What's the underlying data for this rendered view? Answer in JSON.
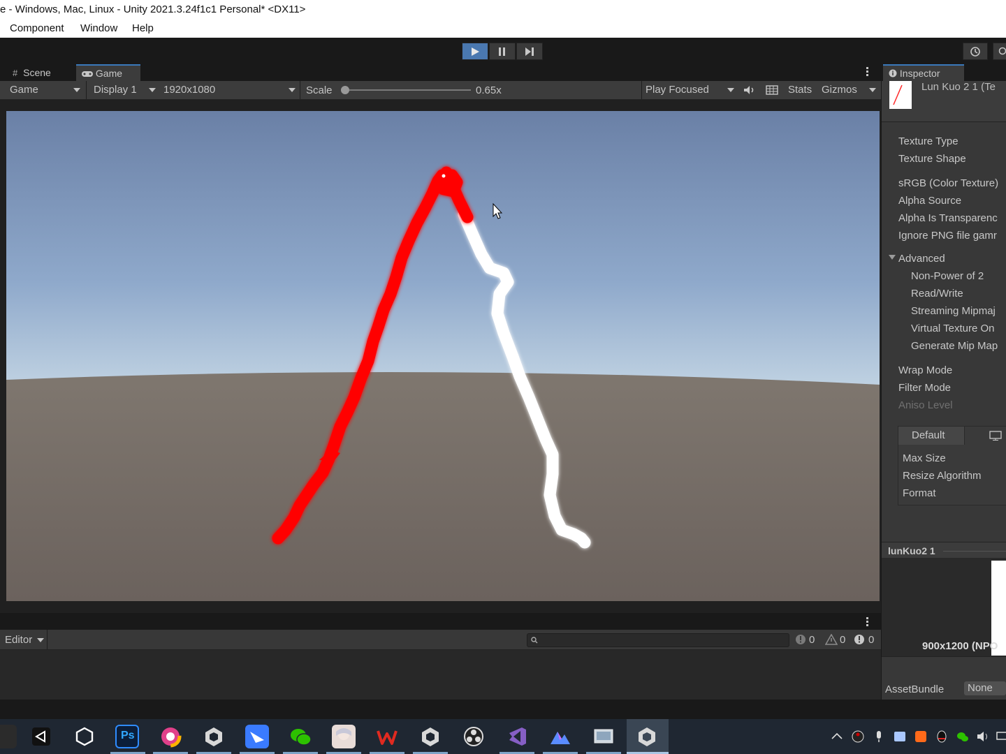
{
  "window": {
    "title": "e - Windows, Mac, Linux - Unity 2021.3.24f1c1 Personal* <DX11>"
  },
  "menu": {
    "items": [
      "Component",
      "Window",
      "Help"
    ]
  },
  "toolbar": {
    "play_icon": "play-icon",
    "pause_icon": "pause-icon",
    "step_icon": "step-icon",
    "history_icon": "history-icon"
  },
  "game_view": {
    "tabs": {
      "scene": "Scene",
      "game": "Game"
    },
    "mode": "Game",
    "display": "Display 1",
    "resolution": "1920x1080",
    "scale_label": "Scale",
    "scale_value": "0.65x",
    "scale_level": 0.0,
    "play_mode": "Play Focused",
    "stats": "Stats",
    "gizmos": "Gizmos",
    "stroke_colors": {
      "red": "#ff0000",
      "white": "#ffffff"
    }
  },
  "console": {
    "editor_dropdown": "Editor",
    "search_placeholder": "",
    "count_info": "0",
    "count_warn": "0",
    "count_error": "0"
  },
  "inspector": {
    "tab": "Inspector",
    "asset_name": "Lun Kuo 2 1 (Te",
    "fields": {
      "texture_type": "Texture Type",
      "texture_shape": "Texture Shape",
      "srgb": "sRGB (Color Texture)",
      "alpha_source": "Alpha Source",
      "alpha_transparency": "Alpha Is Transparenc",
      "ignore_png": "Ignore PNG file gamr",
      "advanced": "Advanced",
      "non_power": "Non-Power of 2",
      "read_write": "Read/Write",
      "streaming_mip": "Streaming Mipmaj",
      "virtual_texture": "Virtual Texture On",
      "generate_mip": "Generate Mip Map",
      "wrap_mode": "Wrap Mode",
      "filter_mode": "Filter Mode",
      "aniso_level": "Aniso Level"
    },
    "platform": {
      "default_tab": "Default",
      "max_size": "Max Size",
      "resize_algorithm": "Resize Algorithm",
      "format": "Format"
    },
    "preview": {
      "title": "lunKuo2 1",
      "size_label": "900x1200 (NPO"
    },
    "asset_bundle": {
      "label": "AssetBundle",
      "value": "None"
    }
  },
  "taskbar": {
    "apps": [
      "unity-hub-icon",
      "unity-icon",
      "photoshop-icon",
      "color-picker-icon",
      "unity-editor-icon",
      "feishu-icon",
      "wechat-icon",
      "avatar-app-icon",
      "wps-icon",
      "unity-editor-icon",
      "obs-icon",
      "visual-studio-icon",
      "mountain-app-icon",
      "screen-app-icon",
      "unity-editor-active-icon"
    ],
    "photoshop_label": "Ps"
  }
}
